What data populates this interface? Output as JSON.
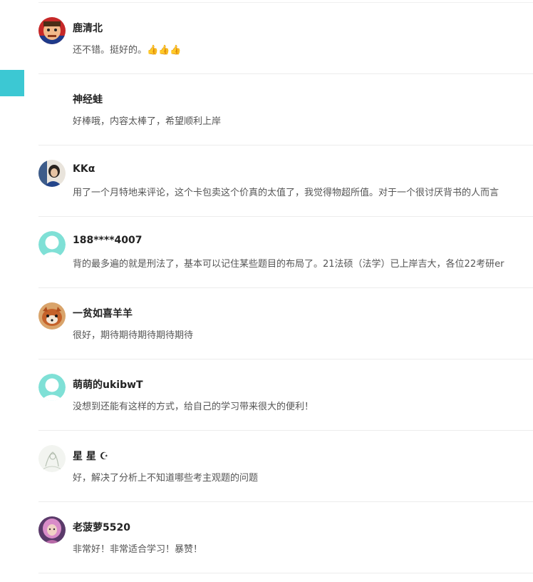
{
  "comments": [
    {
      "name": "鹿清北",
      "text": "还不错。挺好的。",
      "emoji": "👍👍👍",
      "avatar": "cartoon-face-avatar"
    },
    {
      "name": "神经蛙",
      "text": "好棒哦，内容太棒了，希望顺利上岸",
      "avatar": "none"
    },
    {
      "name": "KKα",
      "text": "用了一个月特地来评论，这个卡包卖这个价真的太值了，我觉得物超所值。对于一个很讨厌背书的人而言",
      "avatar": "photo-avatar"
    },
    {
      "name": "188****4007",
      "text": "背的最多遍的就是刑法了，基本可以记住某些题目的布局了。21法硕（法学）已上岸吉大，各位22考研er",
      "avatar": "default-user-avatar"
    },
    {
      "name": "一贫如喜羊羊",
      "text": "很好，期待期待期待期待期待",
      "avatar": "red-panda-avatar"
    },
    {
      "name": "萌萌的ukibwT",
      "text": "没想到还能有这样的方式，给自己的学习带来很大的便利！",
      "avatar": "default-user-avatar"
    },
    {
      "name": "星 星 ☪",
      "text": "好，解决了分析上不知道哪些考主观题的问题",
      "avatar": "sketch-avatar"
    },
    {
      "name": "老菠萝5520",
      "text": "非常好！非常适合学习！暴赞！",
      "avatar": "pink-hair-avatar"
    }
  ],
  "colors": {
    "accent": "#3cc8d3",
    "default_avatar": "#7fe0d6"
  }
}
